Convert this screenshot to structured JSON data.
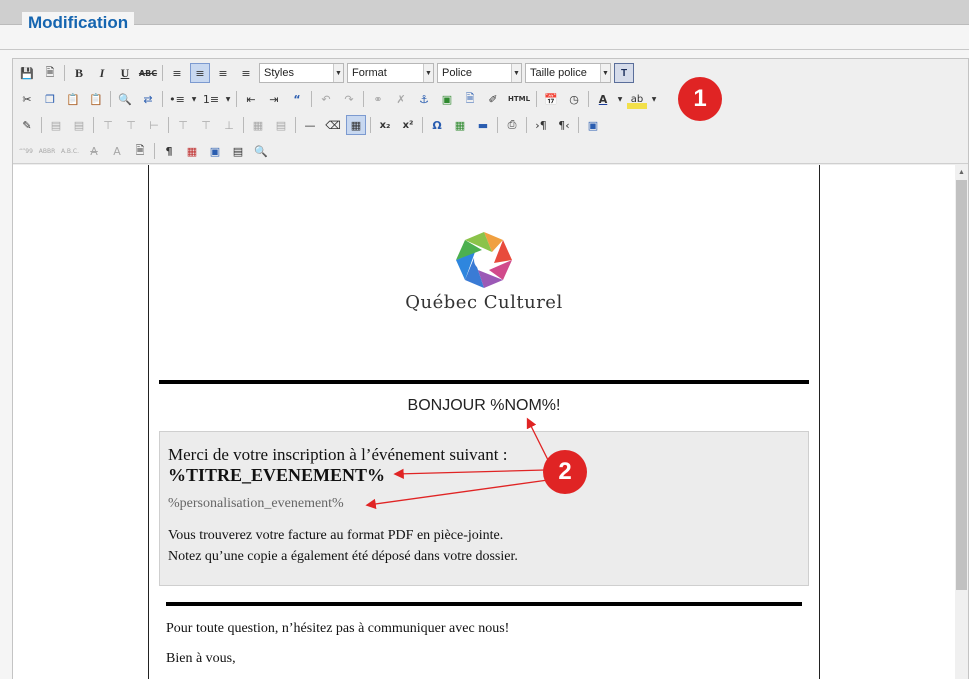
{
  "panel": {
    "title": "Modification"
  },
  "toolbar": {
    "row1": {
      "bold": "B",
      "italic": "I",
      "underline": "U",
      "strike": "ABC",
      "styles": "Styles",
      "format": "Format",
      "font": "Police",
      "size": "Taille police",
      "t_button": "T"
    },
    "row2": {
      "html": "HTML"
    },
    "row4": {
      "abbr1": "“”99",
      "abbr2": "ABBR",
      "abbr3": "A.B.C."
    }
  },
  "badges": {
    "one": "1",
    "two": "2"
  },
  "email": {
    "logo_text": "Québec Culturel",
    "greeting": "BONJOUR %NOM%!",
    "intro": "Merci de votre inscription à l’événement suivant :",
    "event_title": "%TITRE_EVENEMENT%",
    "personalisation": "%personalisation_evenement%",
    "invoice_line": "Vous trouverez votre facture au format PDF en pièce-jointe.",
    "copy_line": "Notez qu’une copie a également été déposé dans votre dossier.",
    "question": "Pour toute question, n’hésitez pas à communiquer avec nous!",
    "signoff": "Bien à vous,"
  },
  "colors": {
    "accent": "#1565b0",
    "badge": "#e02424",
    "arrow": "#e02424"
  },
  "icons": [
    "save-icon",
    "new-page-icon",
    "align-left-icon",
    "align-center-icon",
    "align-right-icon",
    "justify-icon",
    "cut-icon",
    "copy-icon",
    "paste-icon",
    "paste-word-icon",
    "find-icon",
    "replace-icon",
    "bullet-list-icon",
    "numbered-list-icon",
    "outdent-icon",
    "indent-icon",
    "blockquote-icon",
    "undo-icon",
    "redo-icon",
    "link-icon",
    "unlink-icon",
    "anchor-icon",
    "image-icon",
    "media-icon",
    "cleanup-icon",
    "html-icon",
    "insert-date-icon",
    "insert-time-icon",
    "text-color-icon",
    "highlight-icon",
    "edit-css-icon",
    "table-icon",
    "horizontal-rule-icon",
    "eraser-icon",
    "visual-aid-icon",
    "subscript-icon",
    "superscript-icon",
    "special-char-icon",
    "film-icon",
    "input-icon",
    "print-icon",
    "ltr-icon",
    "rtl-icon",
    "fullscreen-icon",
    "pilcrow-icon",
    "nonbreaking-icon",
    "page-break-icon",
    "preview-icon"
  ]
}
